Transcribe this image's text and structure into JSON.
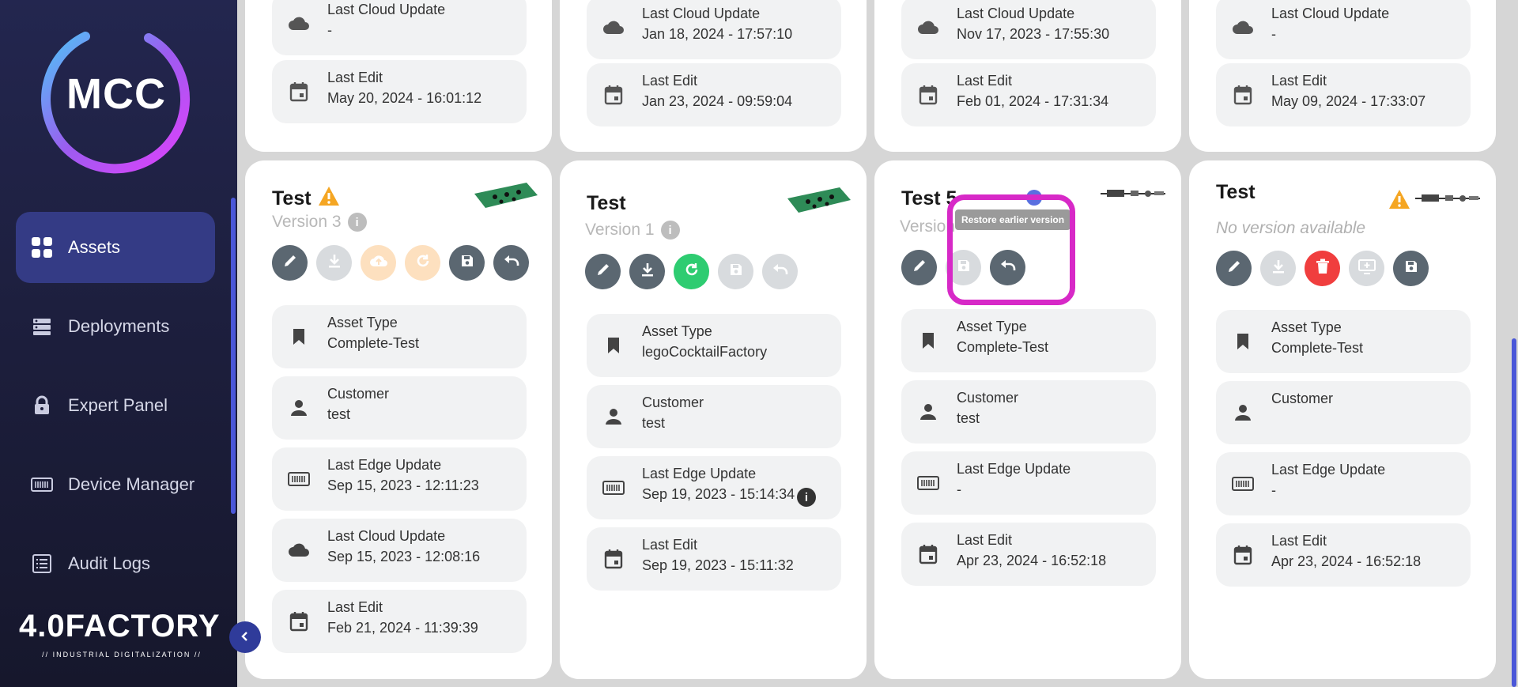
{
  "sidebar": {
    "logo": "MCC",
    "items": [
      {
        "label": "Assets",
        "icon": "grid-icon",
        "active": true
      },
      {
        "label": "Deployments",
        "icon": "server-icon",
        "active": false
      },
      {
        "label": "Expert Panel",
        "icon": "lock-icon",
        "active": false
      },
      {
        "label": "Device Manager",
        "icon": "device-icon",
        "active": false
      },
      {
        "label": "Audit Logs",
        "icon": "list-icon",
        "active": false
      }
    ],
    "brand": "4.0FACTORY",
    "brand_sub": "// INDUSTRIAL DIGITALIZATION //"
  },
  "top_cards": [
    {
      "cloud_label": "Last Cloud Update",
      "cloud_value": "-",
      "edit_label": "Last Edit",
      "edit_value": "May 20, 2024 - 16:01:12"
    },
    {
      "cloud_label": "Last Cloud Update",
      "cloud_value": "Jan 18, 2024 - 17:57:10",
      "edit_label": "Last Edit",
      "edit_value": "Jan 23, 2024 - 09:59:04"
    },
    {
      "cloud_label": "Last Cloud Update",
      "cloud_value": "Nov 17, 2023 - 17:55:30",
      "edit_label": "Last Edit",
      "edit_value": "Feb 01, 2024 - 17:31:34"
    },
    {
      "cloud_label": "Last Cloud Update",
      "cloud_value": "-",
      "edit_label": "Last Edit",
      "edit_value": "May 09, 2024 - 17:33:07"
    }
  ],
  "cards": [
    {
      "title": "Test",
      "version": "Version 3",
      "fields": [
        {
          "label": "Asset Type",
          "value": "Complete-Test",
          "icon": "bookmark-icon"
        },
        {
          "label": "Customer",
          "value": "test",
          "icon": "person-icon"
        },
        {
          "label": "Last Edge Update",
          "value": "Sep 15, 2023 - 12:11:23",
          "icon": "edge-device-icon"
        },
        {
          "label": "Last Cloud Update",
          "value": "Sep 15, 2023 - 12:08:16",
          "icon": "cloud-icon"
        },
        {
          "label": "Last Edit",
          "value": "Feb 21, 2024 - 11:39:39",
          "icon": "calendar-icon"
        }
      ]
    },
    {
      "title": "Test",
      "version": "Version 1",
      "fields": [
        {
          "label": "Asset Type",
          "value": "legoCocktailFactory",
          "icon": "bookmark-icon"
        },
        {
          "label": "Customer",
          "value": "test",
          "icon": "person-icon"
        },
        {
          "label": "Last Edge Update",
          "value": "Sep 19, 2023 - 15:14:34",
          "icon": "edge-device-icon"
        },
        {
          "label": "Last Edit",
          "value": "Sep 19, 2023 - 15:11:32",
          "icon": "calendar-icon"
        }
      ]
    },
    {
      "title": "Test 5",
      "version": "Version",
      "tooltip": "Restore earlier version",
      "fields": [
        {
          "label": "Asset Type",
          "value": "Complete-Test",
          "icon": "bookmark-icon"
        },
        {
          "label": "Customer",
          "value": "test",
          "icon": "person-icon"
        },
        {
          "label": "Last Edge Update",
          "value": "-",
          "icon": "edge-device-icon"
        },
        {
          "label": "Last Edit",
          "value": "Apr 23, 2024 - 16:52:18",
          "icon": "calendar-icon"
        }
      ]
    },
    {
      "title": "Test",
      "version": "No version available",
      "fields": [
        {
          "label": "Asset Type",
          "value": "Complete-Test",
          "icon": "bookmark-icon"
        },
        {
          "label": "Customer",
          "value": "",
          "icon": "person-icon"
        },
        {
          "label": "Last Edge Update",
          "value": "-",
          "icon": "edge-device-icon"
        },
        {
          "label": "Last Edit",
          "value": "Apr 23, 2024 - 16:52:18",
          "icon": "calendar-icon"
        }
      ]
    }
  ],
  "colors": {
    "accent": "#343b85",
    "highlight": "#d729c7",
    "warning": "#f5a623",
    "green": "#2ecc71",
    "red": "#f03e3e"
  }
}
